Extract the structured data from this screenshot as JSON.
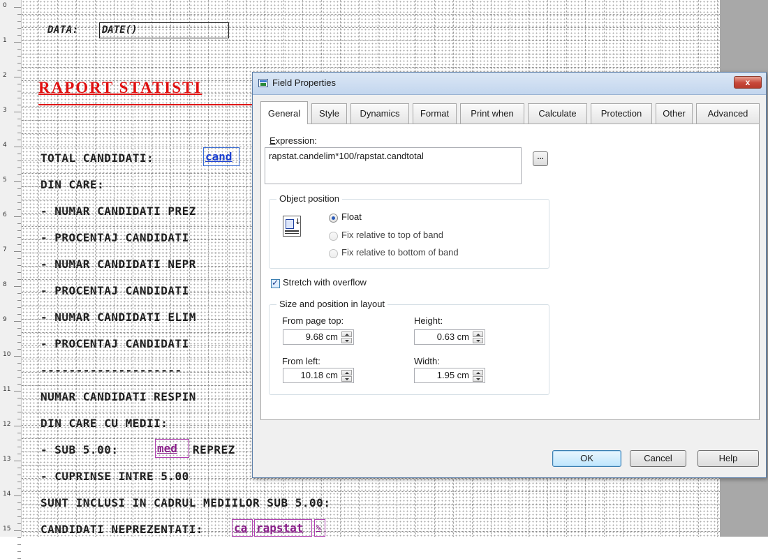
{
  "ruler": {
    "marks": [
      "0",
      "1",
      "2",
      "3",
      "4",
      "5",
      "6",
      "7",
      "8",
      "9",
      "10",
      "11",
      "12",
      "13",
      "14",
      "15"
    ]
  },
  "report": {
    "date_label": "DATA:",
    "date_expr": "DATE()",
    "title": "RAPORT STATISTI",
    "rows": [
      "TOTAL CANDIDATI:",
      "DIN CARE:",
      "- NUMAR CANDIDATI PREZ",
      "- PROCENTAJ CANDIDATI",
      "- NUMAR CANDIDATI NEPR",
      "- PROCENTAJ CANDIDATI",
      "- NUMAR CANDIDATI ELIM",
      "- PROCENTAJ CANDIDATI",
      "--------------------",
      "NUMAR CANDIDATI RESPIN",
      "DIN CARE CU MEDII:",
      "- SUB 5.00:",
      "- CUPRINSE INTRE 5.00",
      "SUNT INCLUSI IN CADRUL MEDIILOR SUB 5.00:",
      "CANDIDATI NEPREZENTATI:"
    ],
    "fields": {
      "total": "cand",
      "sub5": "med",
      "sub5_after": "REPREZ",
      "nep1": "ca",
      "nep2": "rapstat",
      "nep3": "%"
    }
  },
  "dialog": {
    "title": "Field Properties",
    "close_label": "x",
    "tabs": [
      "General",
      "Style",
      "Dynamics",
      "Format",
      "Print when",
      "Calculate",
      "Protection",
      "Other",
      "Advanced"
    ],
    "active_tab": "General",
    "expression_label": "Expression:",
    "expression_value": "rapstat.candelim*100/rapstat.candtotal",
    "expression_button": "...",
    "object_position": {
      "title": "Object position",
      "options": [
        "Float",
        "Fix relative to top of band",
        "Fix relative to bottom of band"
      ],
      "selected": "Float"
    },
    "stretch_label": "Stretch with overflow",
    "stretch_checked": true,
    "size_group": {
      "title": "Size and position in layout",
      "from_page_top_label": "From page top:",
      "from_page_top": "9.68 cm",
      "height_label": "Height:",
      "height": "0.63 cm",
      "from_left_label": "From left:",
      "from_left": "10.18 cm",
      "width_label": "Width:",
      "width": "1.95 cm"
    },
    "buttons": {
      "ok": "OK",
      "cancel": "Cancel",
      "help": "Help"
    }
  }
}
